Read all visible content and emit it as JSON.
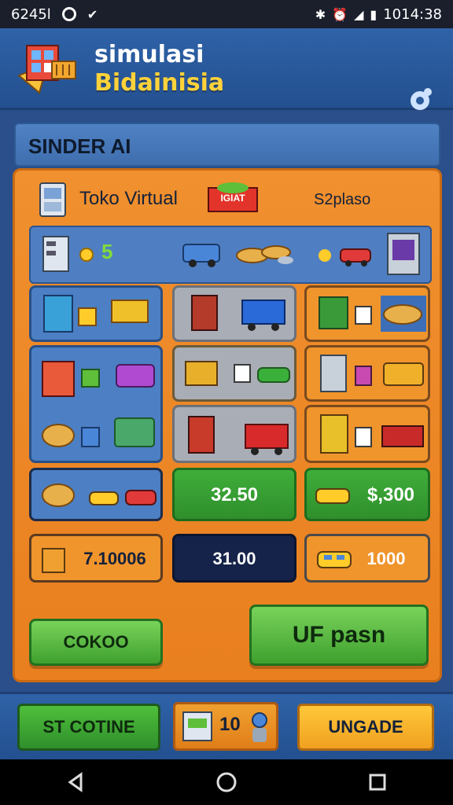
{
  "status_bar": {
    "left_text": "6245l",
    "time": "1014:38"
  },
  "header": {
    "title_line1": "simulasi",
    "title_line2": "Bidainisia"
  },
  "section": {
    "title": "SINDER AI"
  },
  "shop": {
    "name": "Toko Virtual",
    "badge": "IGIAT",
    "subtitle": "S2plaso"
  },
  "inventory_top": {
    "count": "5"
  },
  "value_tiles": {
    "price_a": "32.50",
    "price_b": "$,300",
    "stat_a": "7.10006",
    "stat_b": "31.00",
    "stat_c": "1000"
  },
  "actions": {
    "left_button": "COKOO",
    "right_button": "UF pasn"
  },
  "bottom_bar": {
    "continue_label": "ST COTINE",
    "store_count": "10",
    "upgrade_label": "UNGADE"
  },
  "colors": {
    "panel_orange": "#ec8a27",
    "header_blue": "#2b5b9c",
    "accent_gold": "#ffd23a",
    "button_green": "#4fb43a"
  }
}
